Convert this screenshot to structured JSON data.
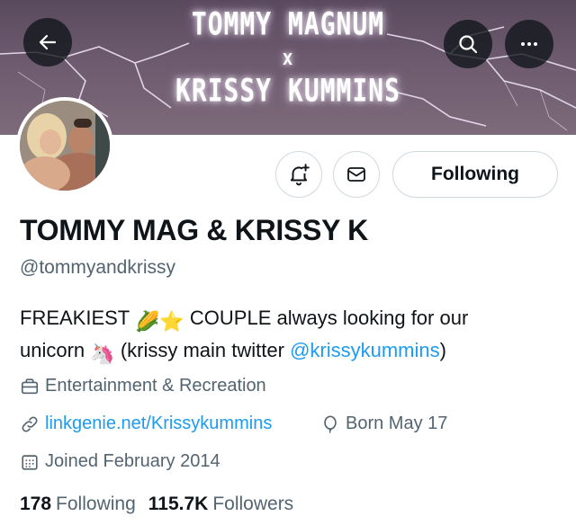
{
  "banner": {
    "line1": "TOMMY MAGNUM",
    "line2": "X",
    "line3": "KRISSY KUMMINS"
  },
  "top_nav": {
    "back_icon": "arrow-left-icon",
    "search_icon": "search-icon",
    "more_icon": "more-horizontal-icon"
  },
  "profile": {
    "display_name": "TOMMY MAG & KRISSY K",
    "handle": "@tommyandkrissy",
    "following_button_label": "Following",
    "bio": {
      "part1": "FREAKIEST",
      "emoji1": "🌽",
      "emoji2": "⭐",
      "part2": "COUPLE always looking for our",
      "part3": "unicorn",
      "emoji3": "🦄",
      "part4": "(krissy main twitter",
      "mention": "@krissykummins",
      "part5": ")"
    },
    "category": "Entertainment & Recreation",
    "website": "linkgenie.net/Krissykummins",
    "birthday": "Born May 17",
    "joined": "Joined February 2014",
    "following_count": "178",
    "following_label": "Following",
    "followers_count": "115.7K",
    "followers_label": "Followers"
  },
  "colors": {
    "accent": "#1d9bf0",
    "text_primary": "#0f1419",
    "text_secondary": "#536471",
    "border": "#cfd9de"
  }
}
